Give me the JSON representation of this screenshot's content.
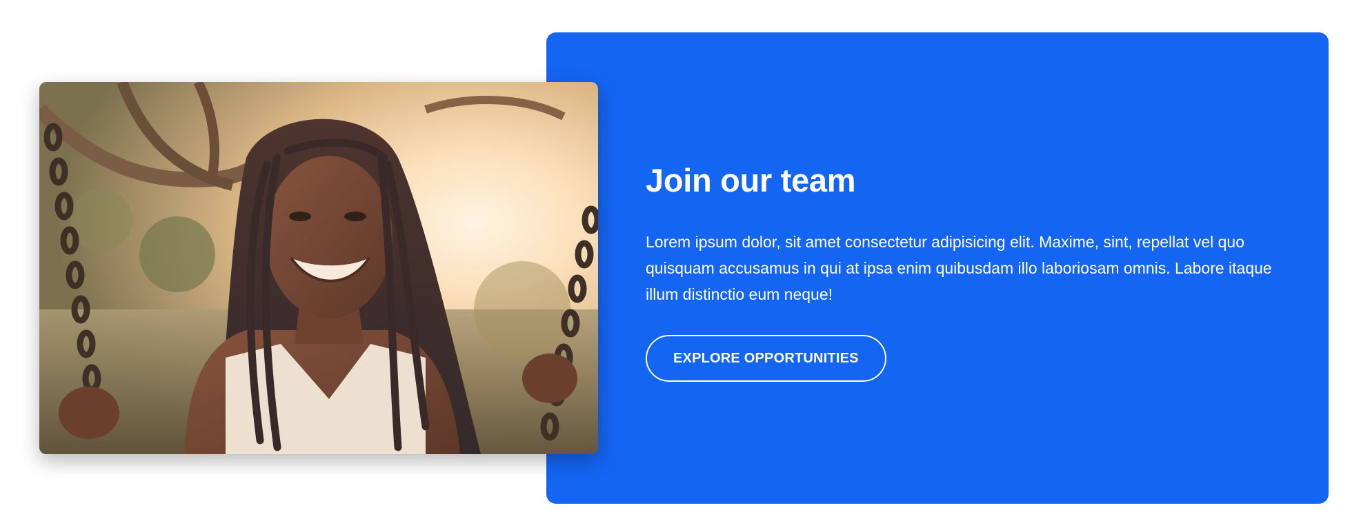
{
  "hero": {
    "title": "Join our team",
    "description": "Lorem ipsum dolor, sit amet consectetur adipisicing elit. Maxime, sint, repellat vel quo quisquam accusamus in qui at ipsa enim quibusdam illo laboriosam omnis. Labore itaque illum distinctio eum neque!",
    "cta_label": "EXPLORE OPPORTUNITIES",
    "image_alt": "woman-on-swing-photo"
  },
  "colors": {
    "panel": "#1465F2",
    "text": "#FFFFFF",
    "page_background": "#FFFFFF"
  }
}
